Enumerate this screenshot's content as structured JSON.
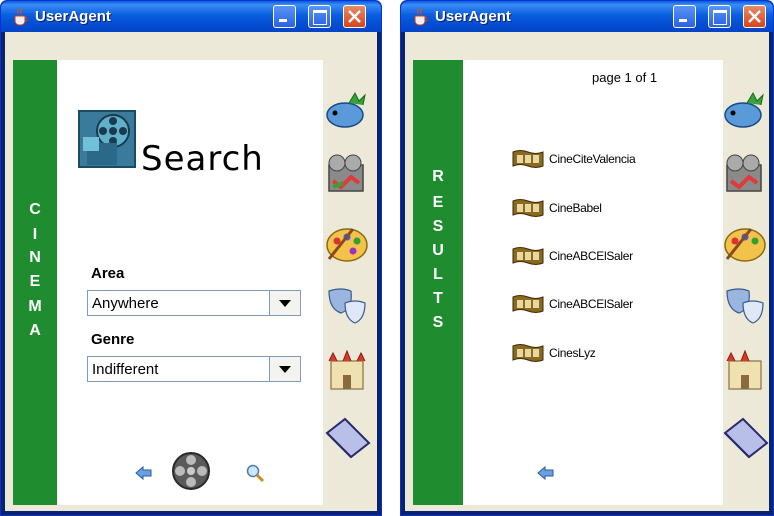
{
  "colors": {
    "title_bar": "#0a5fe0",
    "side_bar_green": "#1f8c2f",
    "window_bg": "#ece9d8"
  },
  "window1": {
    "title": "UserAgent",
    "vertical_label": [
      "C",
      "I",
      "N",
      "E",
      "M",
      "A"
    ],
    "search_logo_text": "Search",
    "area": {
      "label": "Area",
      "value": "Anywhere"
    },
    "genre": {
      "label": "Genre",
      "value": "Indifferent"
    },
    "bottom_icons": [
      "back-arrow-icon",
      "film-reel-icon",
      "magnifier-icon"
    ],
    "side_icons": [
      "fish-icon",
      "film-camera-icon",
      "palette-icon",
      "theater-masks-icon",
      "castle-icon",
      "folder-icon"
    ]
  },
  "window2": {
    "title": "UserAgent",
    "vertical_label": [
      "R",
      "E",
      "S",
      "U",
      "L",
      "T",
      "S"
    ],
    "page_info": "page  1  of  1",
    "results": [
      "CineCiteValencia",
      "CineBabel",
      "CineABCElSaler",
      "CineABCElSaler",
      "CinesLyz"
    ],
    "bottom_icons": [
      "back-arrow-icon"
    ],
    "side_icons": [
      "fish-icon",
      "film-camera-icon",
      "palette-icon",
      "theater-masks-icon",
      "castle-icon",
      "folder-icon"
    ]
  }
}
